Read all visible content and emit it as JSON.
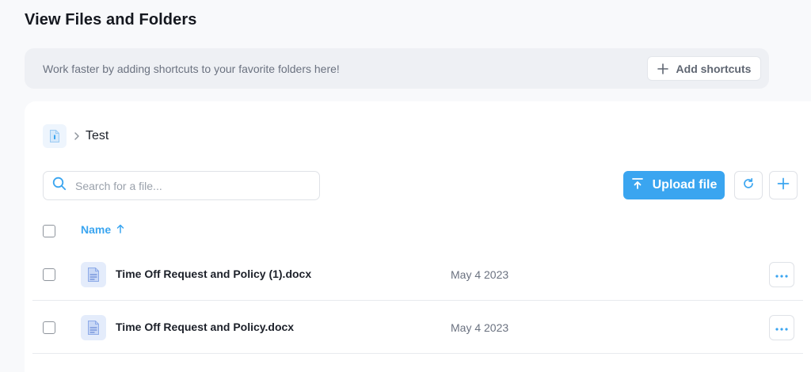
{
  "page": {
    "title": "View Files and Folders"
  },
  "shortcuts": {
    "message": "Work faster by adding shortcuts to your favorite folders here!",
    "add_label": "Add shortcuts"
  },
  "breadcrumb": {
    "root_icon": "folder-icon",
    "current": "Test"
  },
  "toolbar": {
    "search_placeholder": "Search for a file...",
    "upload_label": "Upload file",
    "accent_color": "#3aa5f0"
  },
  "table": {
    "columns": {
      "name": "Name"
    },
    "sort": "ascending",
    "rows": [
      {
        "name": "Time Off Request and Policy (1).docx",
        "date": "May 4 2023",
        "icon": "document-icon"
      },
      {
        "name": "Time Off Request and Policy.docx",
        "date": "May 4 2023",
        "icon": "document-icon"
      }
    ]
  }
}
